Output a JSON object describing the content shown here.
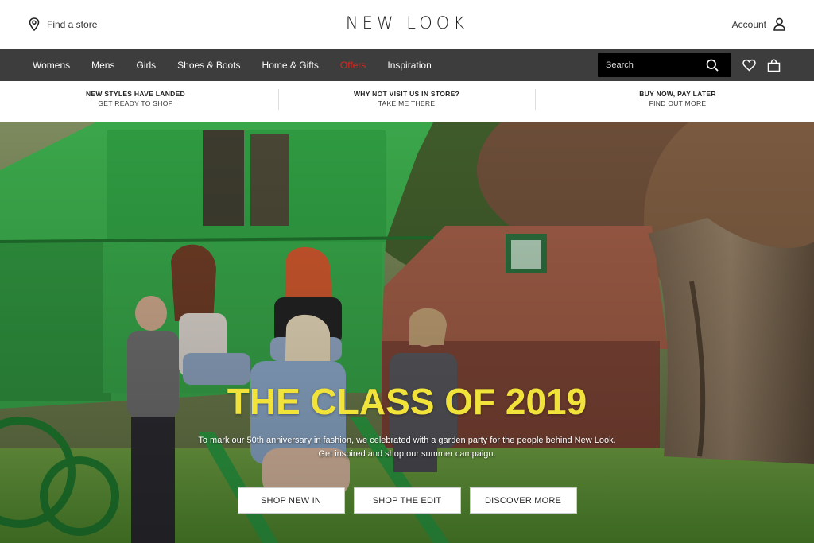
{
  "header": {
    "find_store": "Find a store",
    "logo": "NEW LOOK",
    "account": "Account"
  },
  "nav": {
    "items": [
      {
        "label": "Womens"
      },
      {
        "label": "Mens"
      },
      {
        "label": "Girls"
      },
      {
        "label": "Shoes & Boots"
      },
      {
        "label": "Home & Gifts"
      },
      {
        "label": "Offers"
      },
      {
        "label": "Inspiration"
      }
    ],
    "search_placeholder": "Search",
    "icons": [
      "search-icon",
      "heart-icon",
      "bag-icon"
    ]
  },
  "promo": [
    {
      "title": "NEW STYLES HAVE LANDED",
      "link": "GET READY TO SHOP"
    },
    {
      "title": "WHY NOT VISIT US IN STORE?",
      "link": "TAKE ME THERE"
    },
    {
      "title": "BUY NOW, PAY LATER",
      "link": "FIND OUT MORE"
    }
  ],
  "hero": {
    "title": "THE CLASS OF 2019",
    "subtitle_line1": "To mark our 50th anniversary in fashion, we celebrated with a garden party for the people behind New Look.",
    "subtitle_line2": "Get inspired and shop our summer campaign.",
    "buttons": [
      {
        "label": "SHOP NEW IN"
      },
      {
        "label": "SHOP THE EDIT"
      },
      {
        "label": "DISCOVER MORE"
      }
    ]
  },
  "colors": {
    "nav_bg": "#3d3d3d",
    "offers": "#e0251b",
    "hero_title": "#f2e33a"
  }
}
